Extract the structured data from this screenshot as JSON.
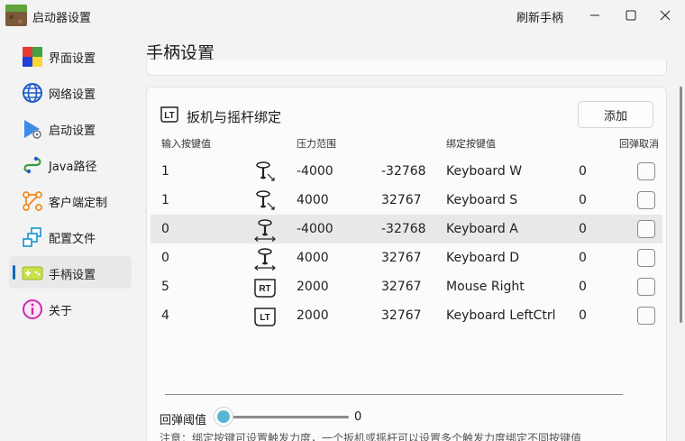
{
  "window": {
    "title": "启动器设置",
    "right_title": "刷新手柄"
  },
  "sidebar": {
    "items": [
      {
        "label": "界面设置",
        "icon": "color-palette-icon"
      },
      {
        "label": "网络设置",
        "icon": "globe-icon"
      },
      {
        "label": "启动设置",
        "icon": "launch-icon"
      },
      {
        "label": "Java路径",
        "icon": "path-icon"
      },
      {
        "label": "客户端定制",
        "icon": "nodes-icon"
      },
      {
        "label": "配置文件",
        "icon": "config-files-icon"
      },
      {
        "label": "手柄设置",
        "icon": "gamepad-icon",
        "selected": true
      },
      {
        "label": "关于",
        "icon": "info-icon"
      }
    ]
  },
  "page": {
    "title": "手柄设置"
  },
  "section": {
    "title": "扳机与摇杆绑定",
    "add_label": "添加"
  },
  "table": {
    "headers": {
      "input": "输入按键值",
      "pressure": "压力范围",
      "bind": "绑定按键值",
      "release": "回弹取消"
    },
    "rows": [
      {
        "input": "1",
        "icon": "stick-right-icon",
        "p1": "-4000",
        "p2": "-32768",
        "key": "Keyboard W",
        "val": "0"
      },
      {
        "input": "1",
        "icon": "stick-right-icon",
        "p1": "4000",
        "p2": "32767",
        "key": "Keyboard S",
        "val": "0"
      },
      {
        "input": "0",
        "icon": "stick-horizontal-icon",
        "p1": "-4000",
        "p2": "-32768",
        "key": "Keyboard A",
        "val": "0",
        "highlight": true
      },
      {
        "input": "0",
        "icon": "stick-horizontal-icon",
        "p1": "4000",
        "p2": "32767",
        "key": "Keyboard D",
        "val": "0"
      },
      {
        "input": "5",
        "icon": "rt-trigger-icon",
        "p1": "2000",
        "p2": "32767",
        "key": "Mouse Right",
        "val": "0"
      },
      {
        "input": "4",
        "icon": "lt-trigger-icon",
        "p1": "2000",
        "p2": "32767",
        "key": "Keyboard LeftCtrl",
        "val": "0"
      }
    ]
  },
  "slider": {
    "label": "回弹阈值",
    "value": "0",
    "fraction": 0
  },
  "note": "注意：绑定按键可设置触发力度，一个扳机或摇杆可以设置多个触发力度绑定不同按键值",
  "icons": {
    "lt": "LT",
    "rt": "RT"
  },
  "colors": {
    "accent": "#0067c0",
    "slider": "#59b7d6"
  }
}
